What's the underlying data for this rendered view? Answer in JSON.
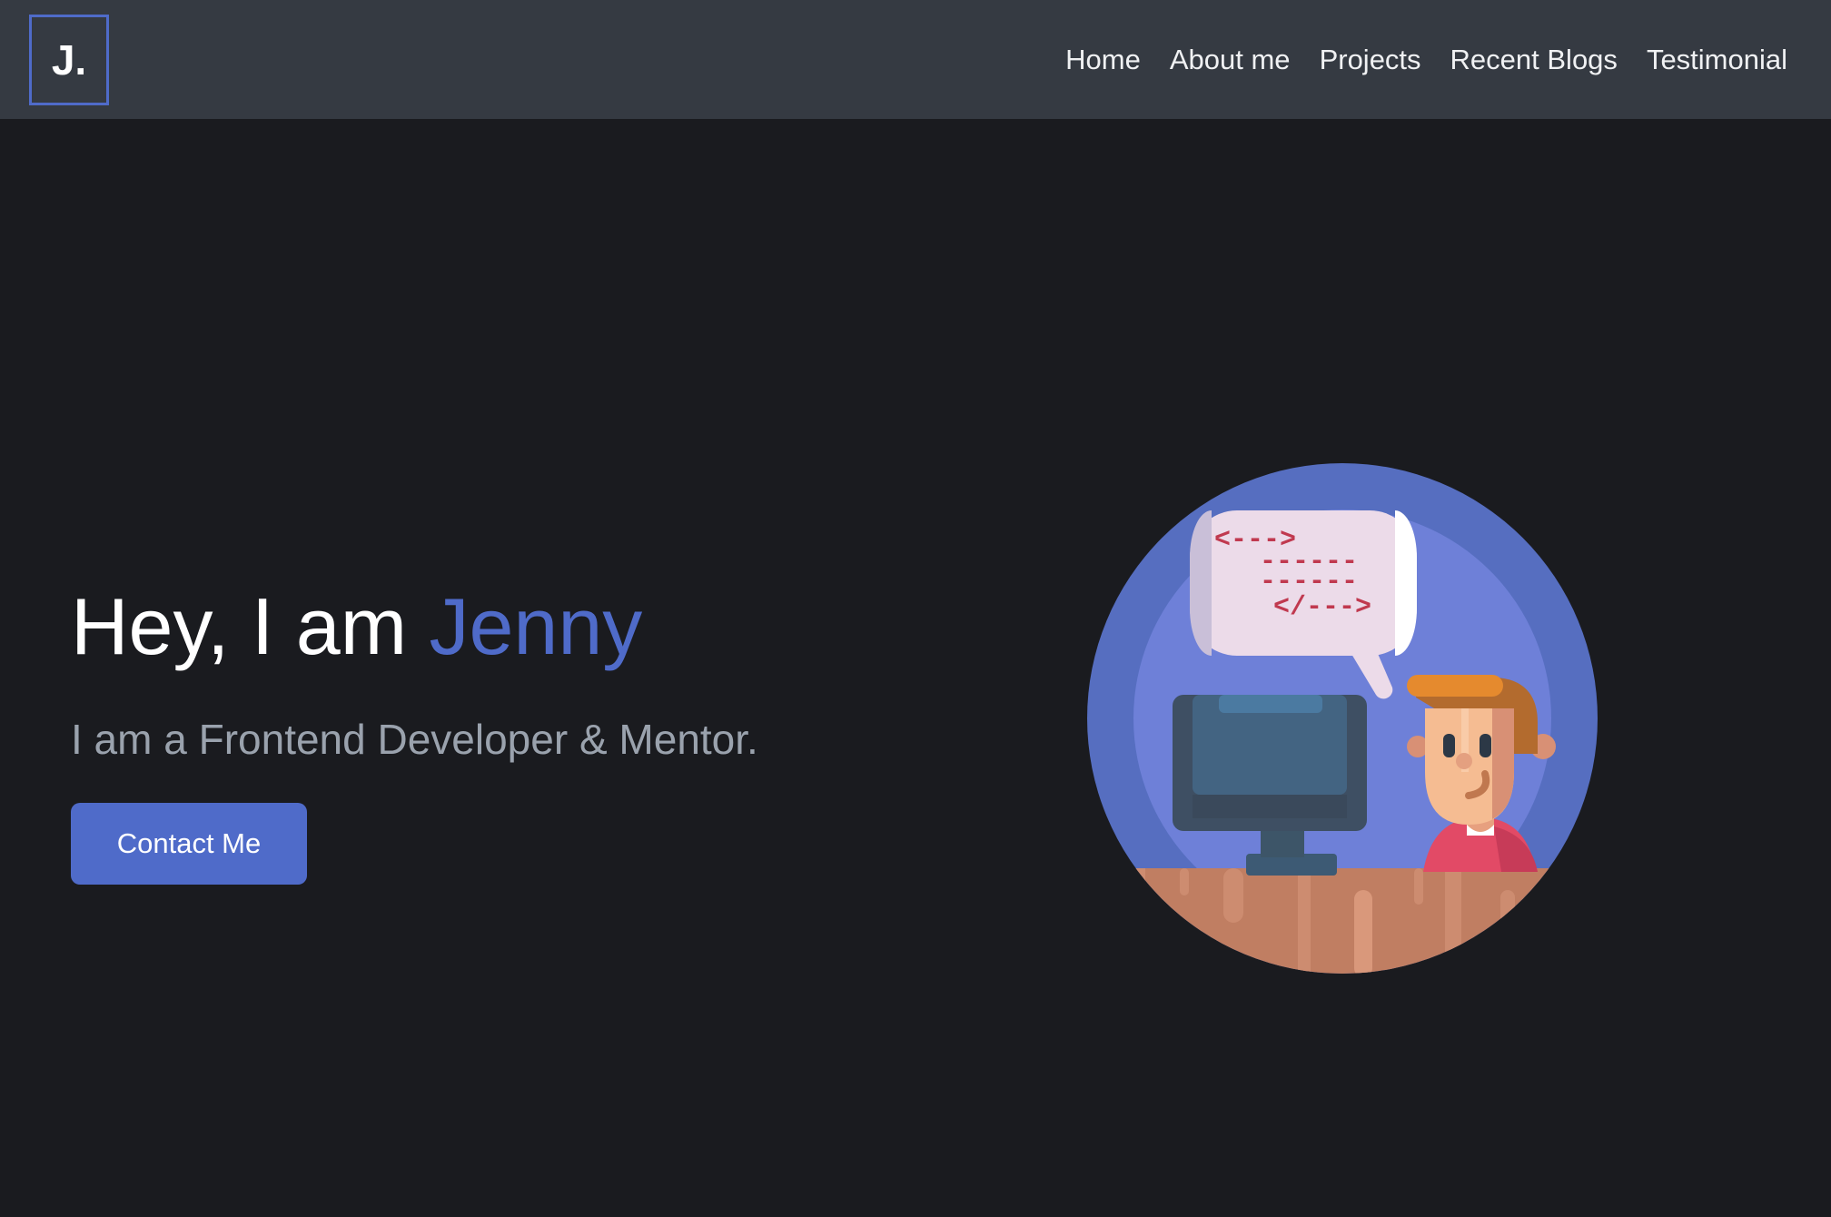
{
  "brand": {
    "logo_text": "J."
  },
  "nav": {
    "items": [
      "Home",
      "About me",
      "Projects",
      "Recent Blogs",
      "Testimonial"
    ]
  },
  "hero": {
    "greeting": "Hey, I am ",
    "name": "Jenny",
    "subtitle": "I am a Frontend Developer & Mentor.",
    "cta_label": "Contact Me"
  },
  "illustration": {
    "code_lines": [
      "<--->",
      "------",
      "------",
      "</--->"
    ]
  },
  "colors": {
    "background": "#1a1b1f",
    "navbar": "#353a42",
    "accent": "#4f6bc9",
    "subtitle": "#9aa2ad"
  },
  "icons": {
    "illustration": "developer-at-computer-illustration"
  }
}
